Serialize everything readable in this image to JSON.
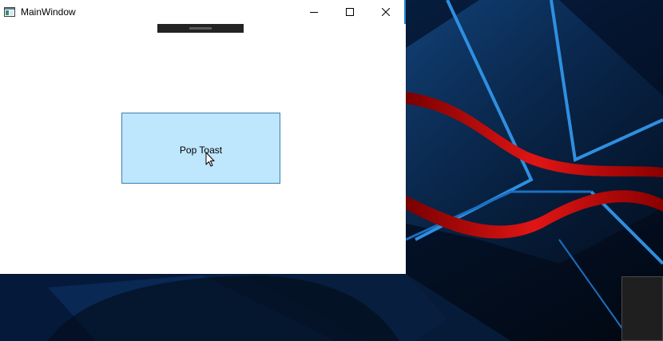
{
  "window": {
    "title": "MainWindow",
    "app_icon": "window-app-icon",
    "controls": {
      "minimize_icon": "minimize-icon",
      "maximize_icon": "maximize-icon",
      "close_icon": "close-icon"
    }
  },
  "main": {
    "button_label": "Pop Toast"
  },
  "colors": {
    "button_background": "#bee6fd",
    "button_border": "#3c7fb1",
    "window_background": "#ffffff",
    "toast_strip": "#232323",
    "desktop_background": "#02040d",
    "wallpaper_accent_blue": "#2f8fe0",
    "wallpaper_accent_red": "#d81010"
  },
  "cursor": {
    "icon": "arrow-cursor-icon"
  }
}
